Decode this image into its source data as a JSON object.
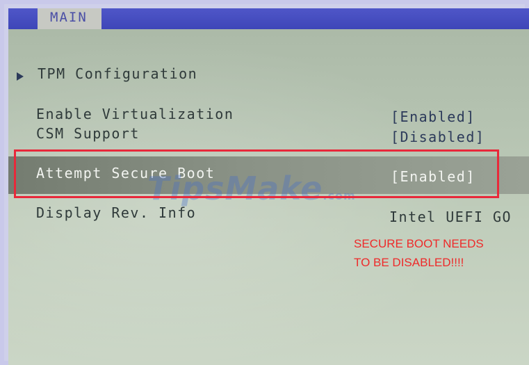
{
  "tabs": {
    "main": "MAIN"
  },
  "menu": {
    "tpm_configuration": "TPM Configuration",
    "enable_virtualization": {
      "label": "Enable Virtualization",
      "value": "[Enabled]"
    },
    "csm_support": {
      "label": "CSM Support",
      "value": "[Disabled]"
    },
    "attempt_secure_boot": {
      "label": "Attempt Secure Boot",
      "value": "[Enabled]"
    },
    "display_rev_info": {
      "label": "Display Rev. Info",
      "value": "Intel UEFI GO"
    }
  },
  "annotation": {
    "line1": "SECURE BOOT NEEDS",
    "line2": "TO BE DISABLED!!!!"
  },
  "watermark": {
    "text": "TipsMake",
    "suffix": ".com"
  },
  "colors": {
    "tab_bar": "#3e46b8",
    "screen_background": "#b4c2b0",
    "highlight_box": "#e8283a",
    "annotation_text": "#ee2a2a"
  },
  "icons": {
    "submenu_arrow": "triangle-right-icon"
  }
}
